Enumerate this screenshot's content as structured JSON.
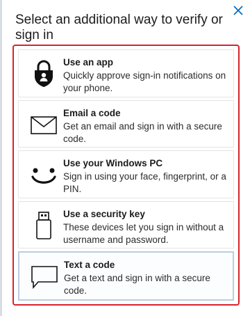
{
  "dialog": {
    "title": "Select an additional way to verify or sign in",
    "close_icon": "close-icon"
  },
  "options": [
    {
      "name": "Use an app",
      "description": "Quickly approve sign-in notifications on your phone.",
      "icon": "authenticator-lock-icon",
      "selected": false
    },
    {
      "name": "Email a code",
      "description": "Get an email and sign in with a secure code.",
      "icon": "envelope-icon",
      "selected": false
    },
    {
      "name": "Use your Windows PC",
      "description": "Sign in using your face, fingerprint, or a PIN.",
      "icon": "smiley-face-icon",
      "selected": false
    },
    {
      "name": "Use a security key",
      "description": "These devices let you sign in without a username and password.",
      "icon": "usb-key-icon",
      "selected": false
    },
    {
      "name": "Text a code",
      "description": "Get a text and sign in with a secure code.",
      "icon": "chat-bubble-icon",
      "selected": true
    }
  ],
  "colors": {
    "highlight_border": "#d9222b",
    "selected_border": "#b9cde3",
    "text": "#1b1b1b",
    "close_icon": "#0067b8"
  }
}
